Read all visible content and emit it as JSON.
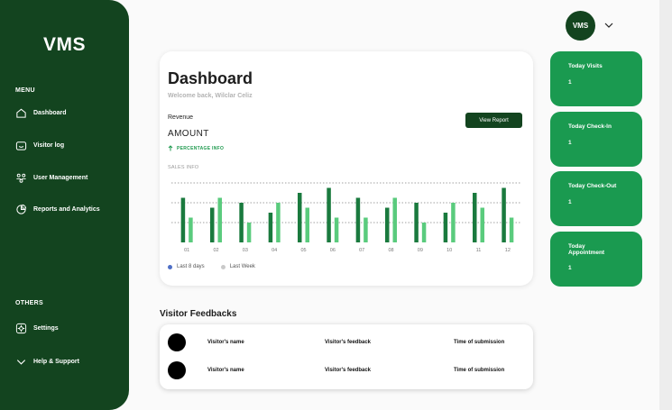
{
  "sidebar": {
    "logo": "VMS",
    "menu_label": "MENU",
    "items": [
      {
        "label": "Dashboard",
        "icon": "home-icon"
      },
      {
        "label": "Visitor log",
        "icon": "visitor-log-icon"
      },
      {
        "label": "User Management",
        "icon": "users-icon"
      },
      {
        "label": "Reports and Analytics",
        "icon": "pie-chart-icon"
      }
    ],
    "others_label": "OTHERS",
    "others": [
      {
        "label": "Settings",
        "icon": "settings-icon"
      },
      {
        "label": "Help & Support",
        "icon": "chevron-down-icon"
      }
    ]
  },
  "header": {
    "avatar_text": "VMS",
    "menu_icon": "chevron-down-icon"
  },
  "dashboard": {
    "title": "Dashboard",
    "welcome": "Welcome back, Wilclar Celiz",
    "revenue_label": "Revenue",
    "view_report": "View Report",
    "amount": "AMOUNT",
    "percentage_info": "PERCENTAGE INFO",
    "sales_info": "SALES INFO"
  },
  "chart_data": {
    "type": "bar",
    "categories": [
      "01",
      "02",
      "03",
      "04",
      "05",
      "06",
      "07",
      "08",
      "09",
      "10",
      "11",
      "12"
    ],
    "series": [
      {
        "name": "Last 8 days",
        "values": [
          4.5,
          3.5,
          4,
          3,
          5,
          5.5,
          4.5,
          3.5,
          4,
          3,
          5,
          5.5
        ]
      },
      {
        "name": "Last Week",
        "values": [
          2.5,
          4.5,
          2,
          4,
          3.5,
          2.5,
          2.5,
          4.5,
          2,
          4,
          3.5,
          2.5
        ]
      }
    ],
    "ylim": [
      0,
      6
    ],
    "gridlines": [
      2,
      4,
      6
    ],
    "colors": [
      "#1a7a3e",
      "#5acb7d"
    ],
    "legend_dot_colors": [
      "#4f6fc6",
      "#c9c9c9"
    ],
    "title": "",
    "xlabel": "",
    "ylabel": ""
  },
  "stats": [
    {
      "label": "Today Visits",
      "value": "1"
    },
    {
      "label": "Today Check-In",
      "value": "1"
    },
    {
      "label": "Today Check-Out",
      "value": "1"
    },
    {
      "label": "Today Appointment",
      "value": "1"
    }
  ],
  "feedbacks": {
    "title": "Visitor Feedbacks",
    "rows": [
      {
        "name": "Visitor's name",
        "feedback": "Visitor's feedback",
        "time": "Time of submission"
      },
      {
        "name": "Visitor's name",
        "feedback": "Visitor's feedback",
        "time": "Time of submission"
      }
    ]
  },
  "colors": {
    "sidebar": "#13441f",
    "accent": "#1a9a50",
    "background": "#fafafa"
  }
}
